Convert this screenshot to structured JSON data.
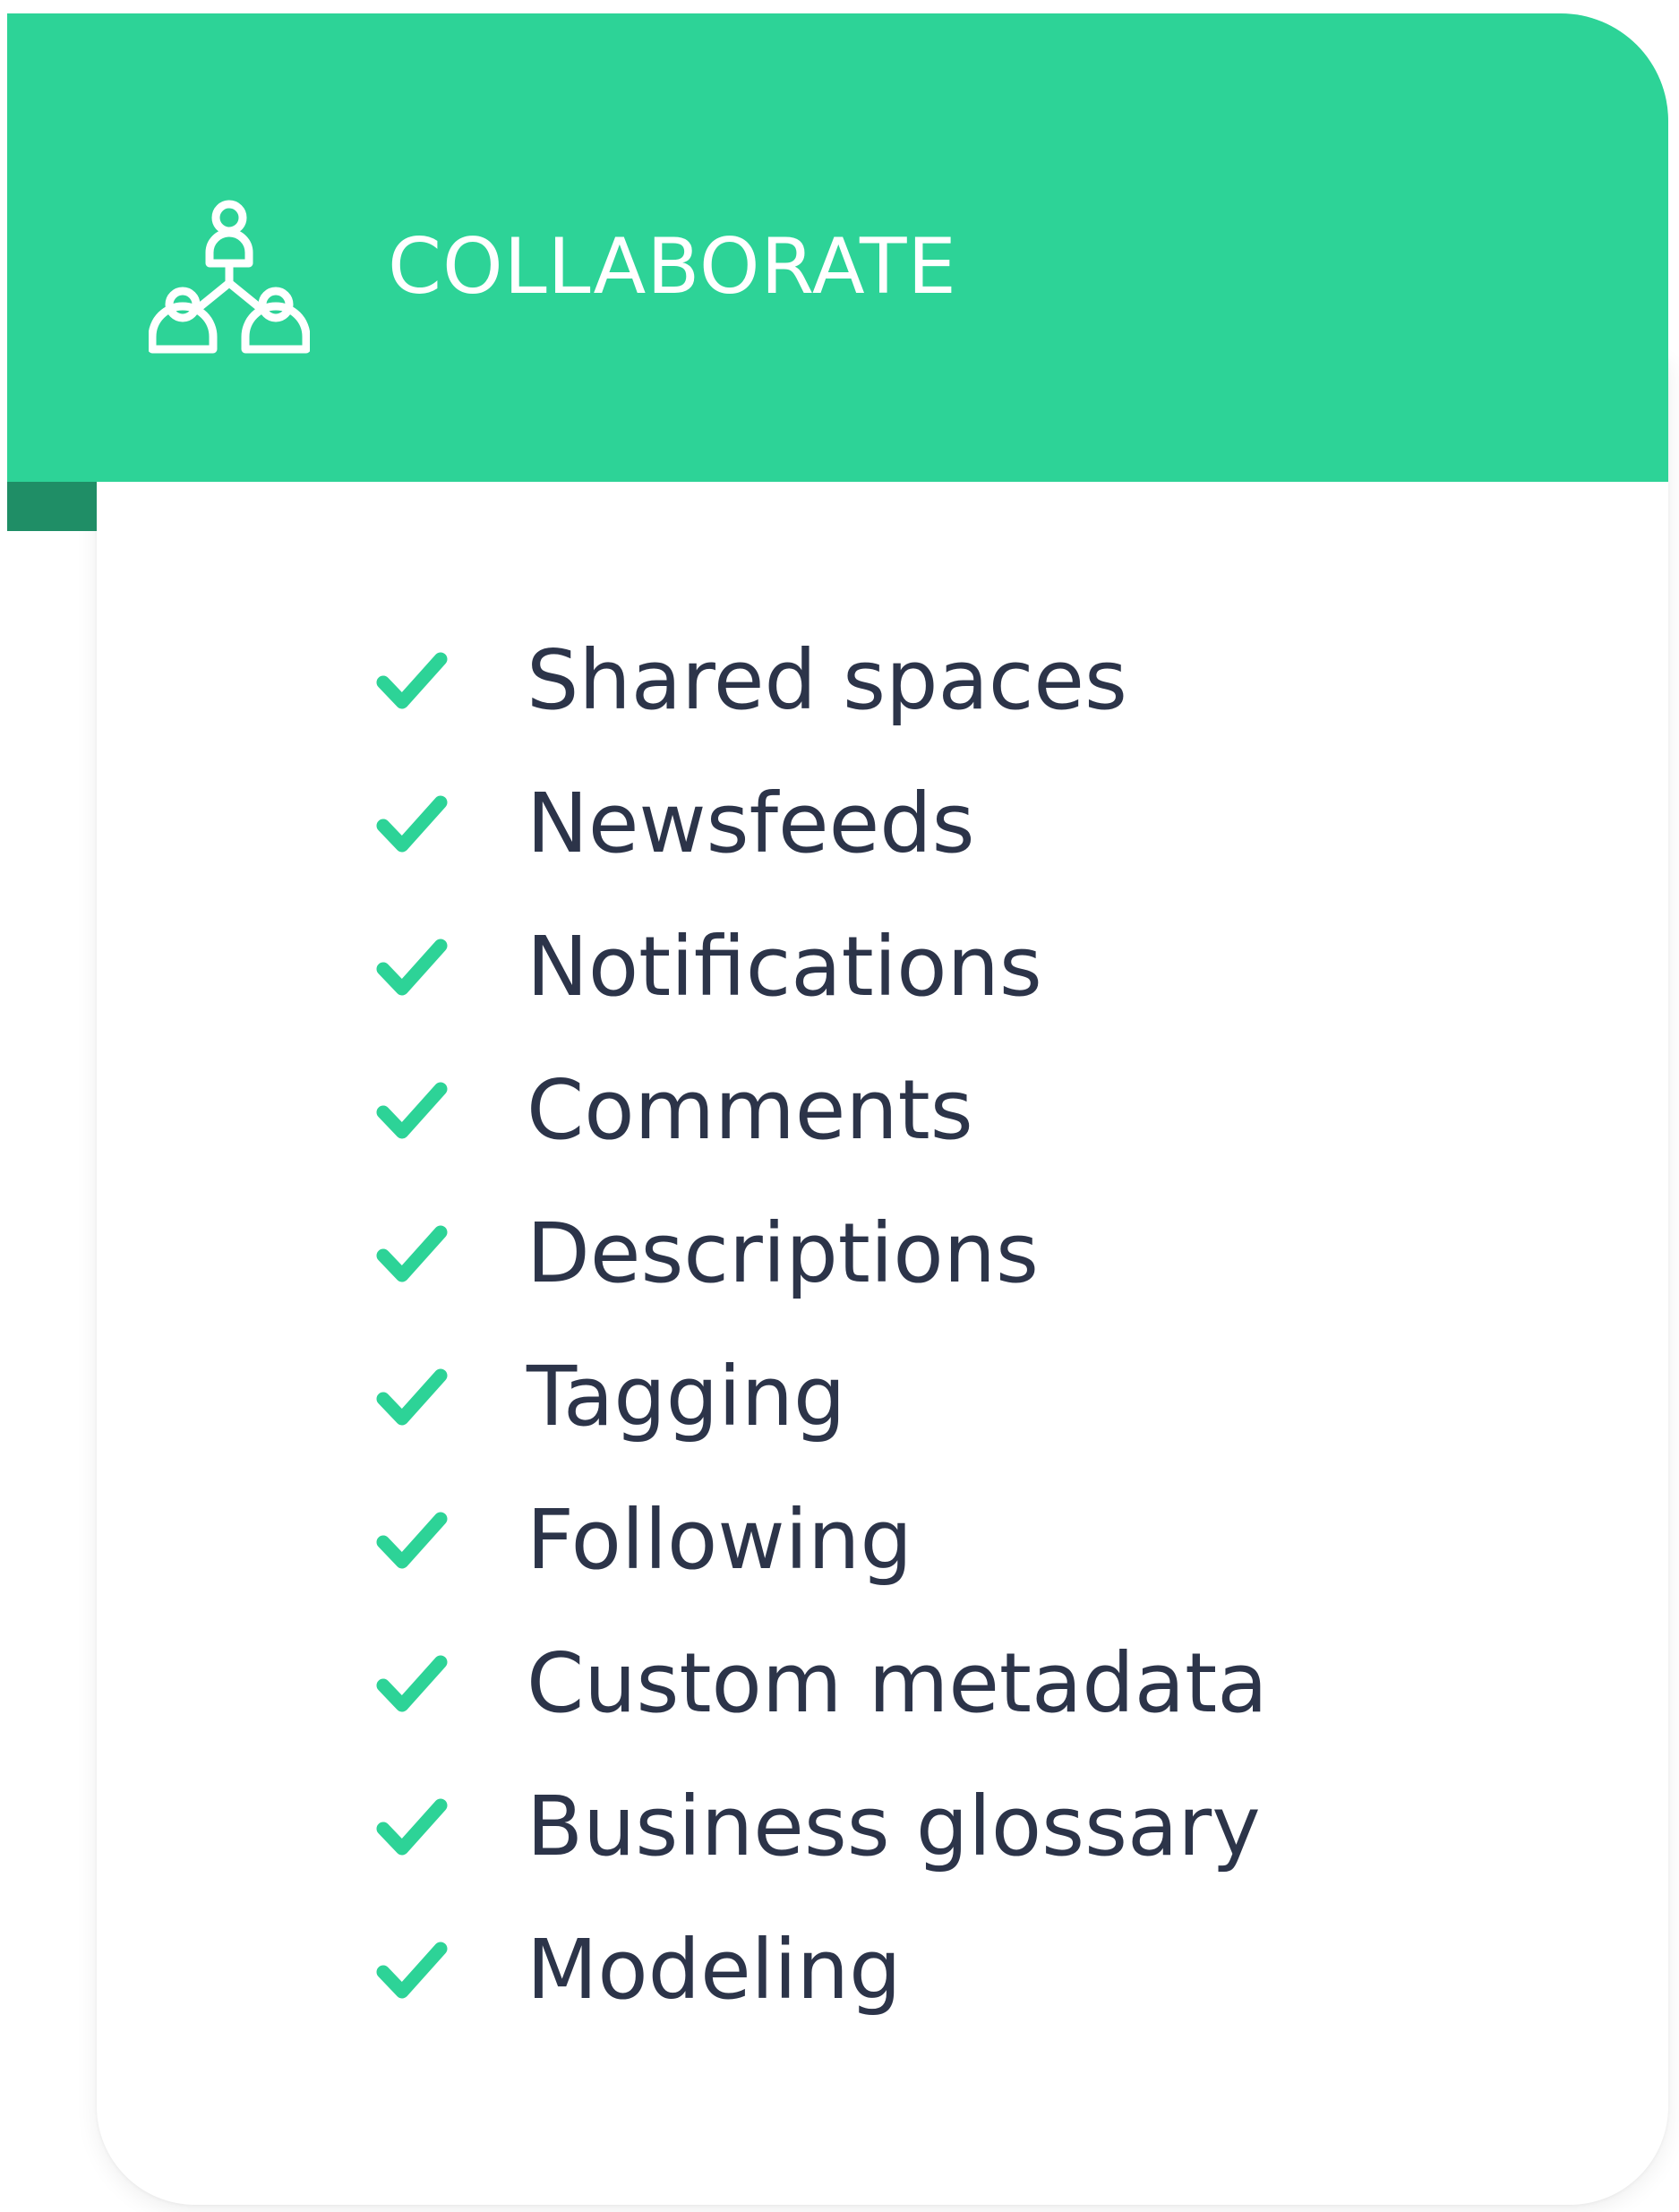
{
  "header": {
    "title": "COLLABORATE",
    "icon": "collaboration-people-icon",
    "background": "#2dd397",
    "fold_color": "#1f8e66"
  },
  "features": {
    "check_icon": "checkmark-icon",
    "check_color": "#2dd397",
    "text_color": "#2c3449",
    "items": [
      {
        "label": "Shared spaces"
      },
      {
        "label": "Newsfeeds"
      },
      {
        "label": "Notifications"
      },
      {
        "label": "Comments"
      },
      {
        "label": "Descriptions"
      },
      {
        "label": "Tagging"
      },
      {
        "label": "Following"
      },
      {
        "label": "Custom metadata"
      },
      {
        "label": "Business glossary"
      },
      {
        "label": "Modeling"
      }
    ]
  }
}
